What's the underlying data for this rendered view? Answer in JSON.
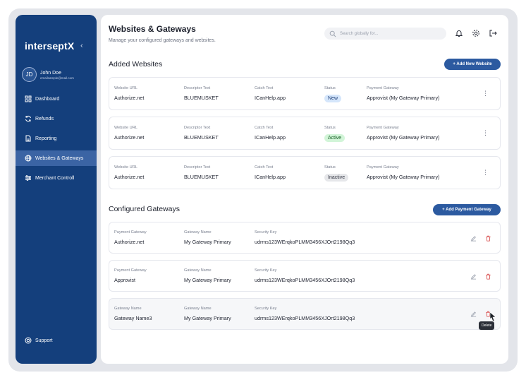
{
  "brand": {
    "logo": "interseptX"
  },
  "user": {
    "initials": "JD",
    "name": "John Doe",
    "email": "emailsample@mail.com"
  },
  "sidebar": {
    "items": [
      {
        "label": "Dashboard",
        "icon": "grid-icon",
        "active": false
      },
      {
        "label": "Refunds",
        "icon": "refresh-icon",
        "active": false
      },
      {
        "label": "Reporting",
        "icon": "document-icon",
        "active": false
      },
      {
        "label": "Websites & Gateways",
        "icon": "globe-icon",
        "active": true
      },
      {
        "label": "Merchant Controll",
        "icon": "sliders-icon",
        "active": false
      }
    ],
    "support_label": "Support"
  },
  "header": {
    "title": "Websites & Gateways",
    "subtitle": "Manage your configured gateways and websites.",
    "search_placeholder": "Search globally for..."
  },
  "websites": {
    "section_title": "Added Websites",
    "add_button": "+ Add New Website",
    "labels": {
      "url": "Website URL",
      "descriptor": "Descriptor Text",
      "catch": "Catch Text",
      "status": "Status",
      "gateway": "Payment Gateway"
    },
    "rows": [
      {
        "url": "Authorize.net",
        "descriptor": "BLUEMUSKET",
        "catch": "ICanHelp.app",
        "status": "New",
        "gateway": "Approvist (My Gateway Primary)"
      },
      {
        "url": "Authorize.net",
        "descriptor": "BLUEMUSKET",
        "catch": "ICanHelp.app",
        "status": "Active",
        "gateway": "Approvist (My Gateway Primary)"
      },
      {
        "url": "Authorize.net",
        "descriptor": "BLUEMUSKET",
        "catch": "ICanHelp.app",
        "status": "Inactive",
        "gateway": "Approvist (My Gateway Primary)"
      }
    ]
  },
  "gateways": {
    "section_title": "Configured Gateways",
    "add_button": "+ Add Payment Gateway",
    "rows": [
      {
        "label1": "Payment Gateway",
        "value1": "Authorize.net",
        "label2": "Gateway Name",
        "value2": "My Gateway Primary",
        "label3": "Security Key",
        "value3": "udrms123WErqkoPLMM3456XJOrt2198Qq3"
      },
      {
        "label1": "Payment Gateway",
        "value1": "Approvist",
        "label2": "Gateway Name",
        "value2": "My Gateway Primary",
        "label3": "Security Key",
        "value3": "udrms123WErqkoPLMM3456XJOrt2198Qq3"
      },
      {
        "label1": "Gateway Name",
        "value1": "Gateway Name3",
        "label2": "Gateway Name",
        "value2": "My Gateway Primary",
        "label3": "Security Key",
        "value3": "udrms123WErqkoPLMM3456XJOrt2198Qq3"
      }
    ],
    "tooltip": "Delete"
  },
  "colors": {
    "sidebar": "#143f7c",
    "active_nav": "#3b64a4",
    "primary_button": "#2c5aa0",
    "delete": "#d64545"
  }
}
